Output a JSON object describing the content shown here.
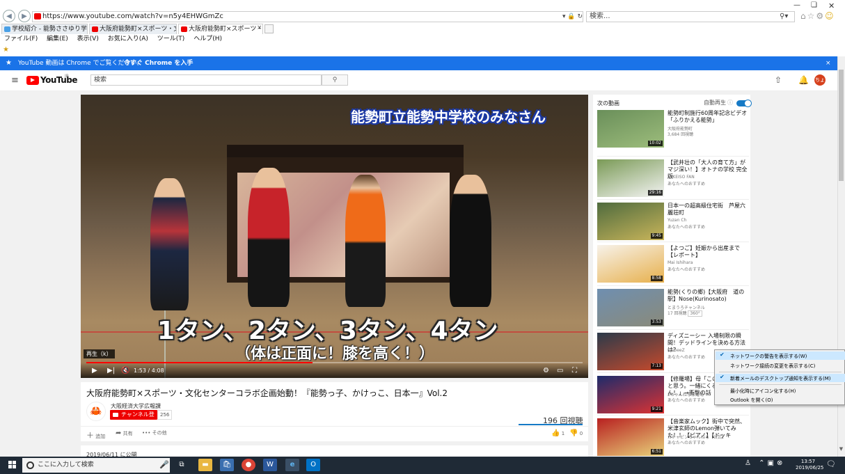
{
  "browser": {
    "url": "https://www.youtube.com/watch?v=n5y4EHWGmZc",
    "search_placeholder": "検索...",
    "tabs": [
      {
        "label": "学校紹介 - 能勢ささゆり学園 【...",
        "color": "#4aa0e6"
      },
      {
        "label": "大阪府能勢町×スポーツ・文化セ...",
        "color": "#e00"
      },
      {
        "label": "大阪府能勢町×スポーツ・文化...",
        "color": "#e00"
      }
    ],
    "tab_close": "×",
    "menu": [
      "ファイル(F)",
      "編集(E)",
      "表示(V)",
      "お気に入り(A)",
      "ツール(T)",
      "ヘルプ(H)"
    ]
  },
  "banner": {
    "text": "YouTube 動画は Chrome でご覧ください。",
    "link": "今すぐ Chrome を入手",
    "close": "×"
  },
  "youtube": {
    "logo_text": "YouTube",
    "logo_region": "JP",
    "search_placeholder": "検索",
    "avatar_text": "ちょ"
  },
  "video": {
    "caption_top": "能勢町立能勢中学校のみなさん",
    "caption_main": "1タン、2タン、3タン、4タン",
    "caption_sub": "（体は正面に！膝を高く！）",
    "cc_label": "再生（k）",
    "time": "1:53 / 4:08",
    "progress": 0.456,
    "title": "大阪府能勢町×スポーツ・文化センターコラボ企画始動！『能勢っ子、かけっこ、日本一』Vol.2",
    "channel": "大阪経済大学広報課",
    "subscribe_label": "チャンネル登録",
    "subscriber_count": "256",
    "views": "196 回視聴",
    "actions": {
      "add": "追加",
      "share": "共有",
      "more": "その他"
    },
    "likes": "1",
    "dislikes": "0",
    "published": "2019/06/11 に公開"
  },
  "sidebar": {
    "next_label": "次の動画",
    "autoplay_label": "自動再生",
    "recommendations": [
      {
        "title": "能勢町制施行60周年記念ビデオ「ふりかえる能勢」",
        "channel": "大阪府能勢町",
        "meta": "3,684 回視聴",
        "duration": "10:02",
        "colors": [
          "#6a8f5a",
          "#9dbd7c"
        ]
      },
      {
        "title": "【武井壮の「大人の育て方」がマジ深い！】オトナの学校 完全版",
        "channel": "TAKEISO FAN",
        "meta": "あなたへのおすすめ",
        "duration": "29:16",
        "colors": [
          "#7a9a56",
          "#f4f4f4"
        ]
      },
      {
        "title": "日本一の超高級住宅街　芦屋六麗荘町",
        "channel": "Yuzan Ch",
        "meta": "あなたへのおすすめ",
        "duration": "9:45",
        "colors": [
          "#4f6b3e",
          "#c9b55a"
        ]
      },
      {
        "title": "【よつご】妊娠から出産まで【レポート】",
        "channel": "Mai Ishihara",
        "meta": "あなたへのおすすめ",
        "duration": "8:58",
        "colors": [
          "#f7f2ea",
          "#e7b04c"
        ]
      },
      {
        "title": "能勢(くりの郷)【大阪府　道の駅】Nose(Kurinosato)",
        "channel": "とまうろチャンネル",
        "meta": "17 回視聴",
        "badge": "360°",
        "duration": "3:53",
        "colors": [
          "#6f8fb0",
          "#8a8a7a"
        ]
      },
      {
        "title": "ディズニーシー 入場制限の瞬間！デッドラインを決める方法は？",
        "channel": "DisbeeZ",
        "meta": "あなたへのおすすめ",
        "duration": "7:13",
        "colors": [
          "#2b3a4a",
          "#c74a2c"
        ]
      },
      {
        "title": "【修羅場】母「この家を出ようと思う。一緒にくる？」私「うん！」→衝撃の話【修羅場】",
        "channel": "2ちゃんねる修羅場",
        "meta": "あなたへのおすすめ",
        "duration": "9:21",
        "colors": [
          "#1d2b6b",
          "#d33"
        ]
      },
      {
        "title": "【音楽家ムック】街中で突然、米津玄師のLemon弾いてみた！！【ピアノ】【ドッキ",
        "channel": "ガチャピンちゃんねる【公式】",
        "meta": "あなたへのおすすめ",
        "duration": "6:51",
        "colors": [
          "#b82020",
          "#e8d27a"
        ]
      }
    ]
  },
  "context_menu": {
    "items": [
      {
        "label": "ネットワークの警告を表示する(W)",
        "checked": true
      },
      {
        "label": "ネットワーク接続の変更を表示する(C)",
        "checked": false
      },
      {
        "label": "新着メールのデスクトップ通知を表示する(M)",
        "checked": true
      },
      {
        "label": "最小化時にアイコン化する(H)",
        "checked": false
      },
      {
        "label": "Outlook を開く(O)",
        "checked": false
      }
    ]
  },
  "taskbar": {
    "search_placeholder": "ここに入力して検索",
    "time": "13:57",
    "date": "2019/06/25"
  }
}
